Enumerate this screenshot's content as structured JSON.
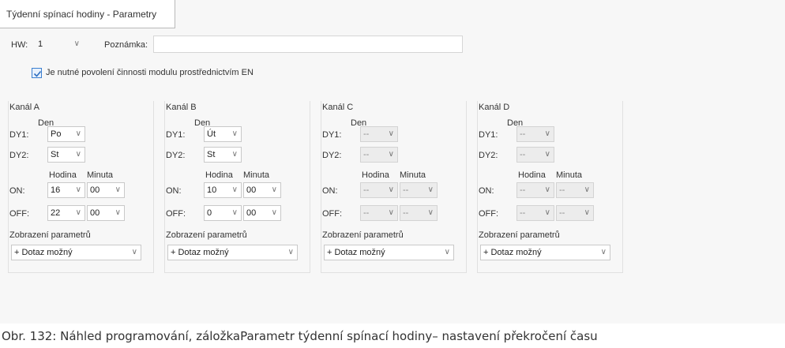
{
  "tab": {
    "title": "Týdenní spínací hodiny - Parametry"
  },
  "hw": {
    "label": "HW:",
    "value": "1"
  },
  "note": {
    "label": "Poznámka:",
    "value": ""
  },
  "enable_checkbox": {
    "label": "Je nutné povolení činnosti modulu prostřednictvím EN",
    "checked": true
  },
  "column_headers": {
    "day": "Den",
    "hour": "Hodina",
    "minute": "Minuta"
  },
  "row_labels": {
    "dy1": "DY1:",
    "dy2": "DY2:",
    "on": "ON:",
    "off": "OFF:"
  },
  "display_label": "Zobrazení parametrů",
  "channels": [
    {
      "title": "Kanál A",
      "dy1": "Po",
      "dy2": "St",
      "on_hour": "16",
      "on_minute": "00",
      "off_hour": "22",
      "off_minute": "00",
      "display": "+ Dotaz možný",
      "enabled": true
    },
    {
      "title": "Kanál B",
      "dy1": "Út",
      "dy2": "St",
      "on_hour": "10",
      "on_minute": "00",
      "off_hour": "0",
      "off_minute": "00",
      "display": "+ Dotaz možný",
      "enabled": true
    },
    {
      "title": "Kanál C",
      "dy1": "--",
      "dy2": "--",
      "on_hour": "--",
      "on_minute": "--",
      "off_hour": "--",
      "off_minute": "--",
      "display": "+ Dotaz možný",
      "enabled": false
    },
    {
      "title": "Kanál D",
      "dy1": "--",
      "dy2": "--",
      "on_hour": "--",
      "on_minute": "--",
      "off_hour": "--",
      "off_minute": "--",
      "display": "+ Dotaz možný",
      "enabled": false
    }
  ],
  "caption": "Obr. 132: Náhled programování, záložkaParametr týdenní spínací hodiny– nastavení překročení času"
}
